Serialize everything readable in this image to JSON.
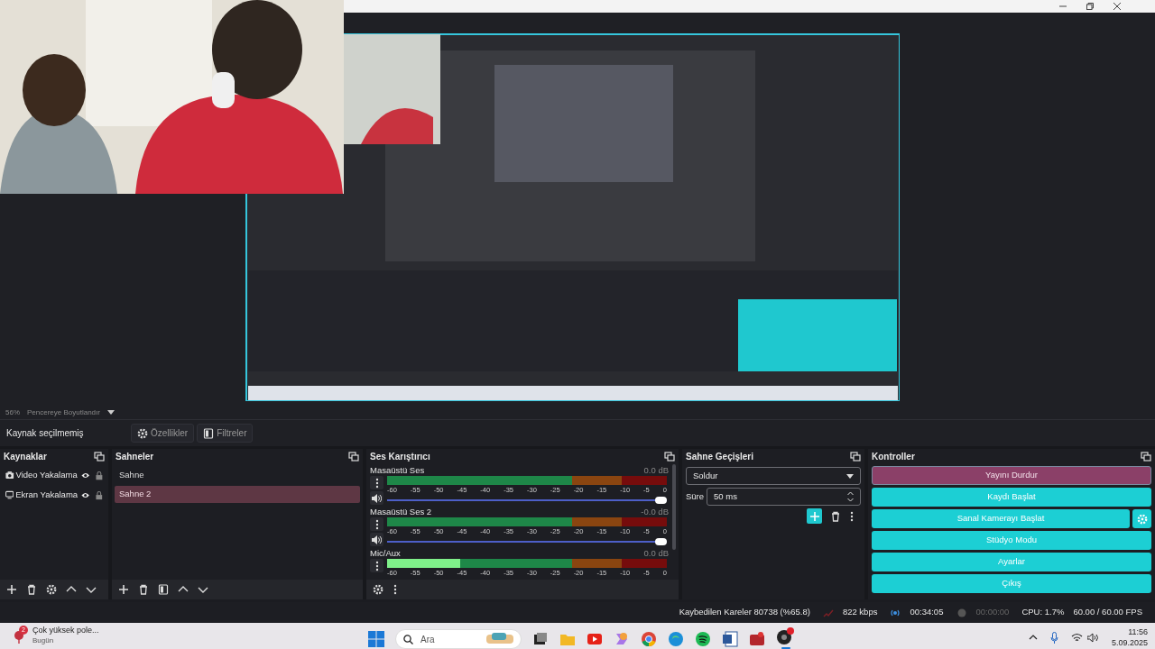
{
  "preview": {
    "kind": "picture",
    "zoom": "56%",
    "scale_mode": "Pencereye Boyutlandır"
  },
  "source_toolbar": {
    "label": "Kaynak seçilmemiş",
    "properties": "Özellikler",
    "filters": "Filtreler"
  },
  "sources": {
    "title": "Kaynaklar",
    "items": [
      {
        "name": "Video Yakalama",
        "kind": "camera"
      },
      {
        "name": "Ekran Yakalama",
        "kind": "display"
      }
    ]
  },
  "scenes": {
    "title": "Sahneler",
    "items": [
      {
        "name": "Sahne",
        "selected": false
      },
      {
        "name": "Sahne 2",
        "selected": true
      }
    ]
  },
  "mixer": {
    "title": "Ses Karıştırıcı",
    "channels": [
      {
        "name": "Masaüstü Ses",
        "reading": "0.0 dB",
        "ticks": [
          "-60",
          "-55",
          "-50",
          "-45",
          "-40",
          "-35",
          "-30",
          "-25",
          "-20",
          "-15",
          "-10",
          "-5",
          "0"
        ],
        "volume": {
          "level": 1
        }
      },
      {
        "name": "Masaüstü Ses 2",
        "reading": "-0.0 dB",
        "ticks": [
          "-60",
          "-55",
          "-50",
          "-45",
          "-40",
          "-35",
          "-30",
          "-25",
          "-20",
          "-15",
          "-10",
          "-5",
          "0"
        ],
        "volume": {
          "level": 1
        }
      },
      {
        "name": "Mic/Aux",
        "reading": "0.0 dB",
        "ticks": [
          "-60",
          "-55",
          "-50",
          "-45",
          "-40",
          "-35",
          "-30",
          "-25",
          "-20",
          "-15",
          "-10",
          "-5",
          "0"
        ],
        "meter": {
          "level": 0.26
        }
      }
    ]
  },
  "transitions": {
    "title": "Sahne Geçişleri",
    "type": "Soldur",
    "duration_label": "Süre",
    "duration": "50 ms"
  },
  "controls": {
    "title": "Kontroller",
    "buttons": [
      {
        "label": "Yayını Durdur",
        "kind": "active"
      },
      {
        "label": "Kaydı Başlat",
        "kind": "normal"
      },
      {
        "label": "Sanal Kamerayı Başlat",
        "kind": "with_settings"
      },
      {
        "label": "Stüdyo Modu",
        "kind": "normal"
      },
      {
        "label": "Ayarlar",
        "kind": "normal"
      },
      {
        "label": "Çıkış",
        "kind": "normal"
      }
    ]
  },
  "status_bar": {
    "dropped_frames": "Kaybedilen Kareler 80738 (%65.8)",
    "bitrate": "822 kbps",
    "stream_time": "00:34:05",
    "record_time": "00:00:00",
    "cpu": "CPU: 1.7%",
    "fps": "60.00 / 60.00 FPS"
  },
  "taskbar": {
    "notification": {
      "badge": "2",
      "title": "Çok yüksek pole...",
      "subtitle": "Bugün"
    },
    "search": {
      "placeholder": "Ara"
    },
    "time": "11:56",
    "date": "5.09.2025"
  }
}
